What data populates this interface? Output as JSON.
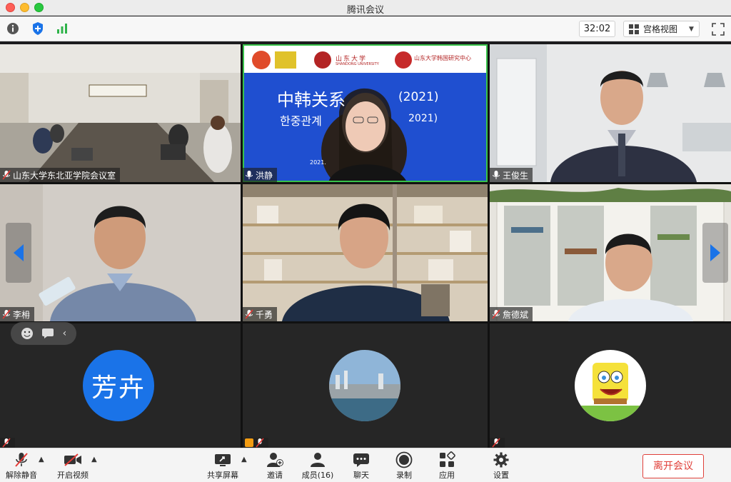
{
  "window": {
    "title": "腾讯会议"
  },
  "toolbar_top": {
    "timer": "32:02",
    "view_label": "宫格视图"
  },
  "participants": [
    {
      "name": "山东大学东北亚学院会议室",
      "mic": "muted"
    },
    {
      "name": "洪静",
      "mic": "on",
      "active": true
    },
    {
      "name": "王俊生",
      "mic": "on"
    },
    {
      "name": "李枏",
      "mic": "muted"
    },
    {
      "name": "千勇",
      "mic": "muted"
    },
    {
      "name": "詹德斌",
      "mic": "muted"
    },
    {
      "name": "芳卉",
      "avatar_text": "芳卉",
      "avatar_color": "#1a73e8"
    },
    {
      "name": ""
    },
    {
      "name": ""
    }
  ],
  "slide": {
    "title_cn": "中韩关系",
    "title_year": "(2021)",
    "title_kr": "한중관계",
    "subtitle_year": "2021)",
    "org1": "山东大学",
    "org1_en": "SHANDONG UNIVERSITY",
    "org2": "山东大学韩国研究中心",
    "footer": "2021."
  },
  "bottom_toolbar": {
    "unmute": "解除静音",
    "start_video": "开启视频",
    "share": "共享屏幕",
    "invite": "邀请",
    "members": "成员(16)",
    "chat": "聊天",
    "record": "录制",
    "apps": "应用",
    "settings": "设置",
    "leave": "离开会议"
  },
  "colors": {
    "active_border": "#38c34a",
    "leave_red": "#e0403a",
    "accent_blue": "#1a73e8"
  }
}
